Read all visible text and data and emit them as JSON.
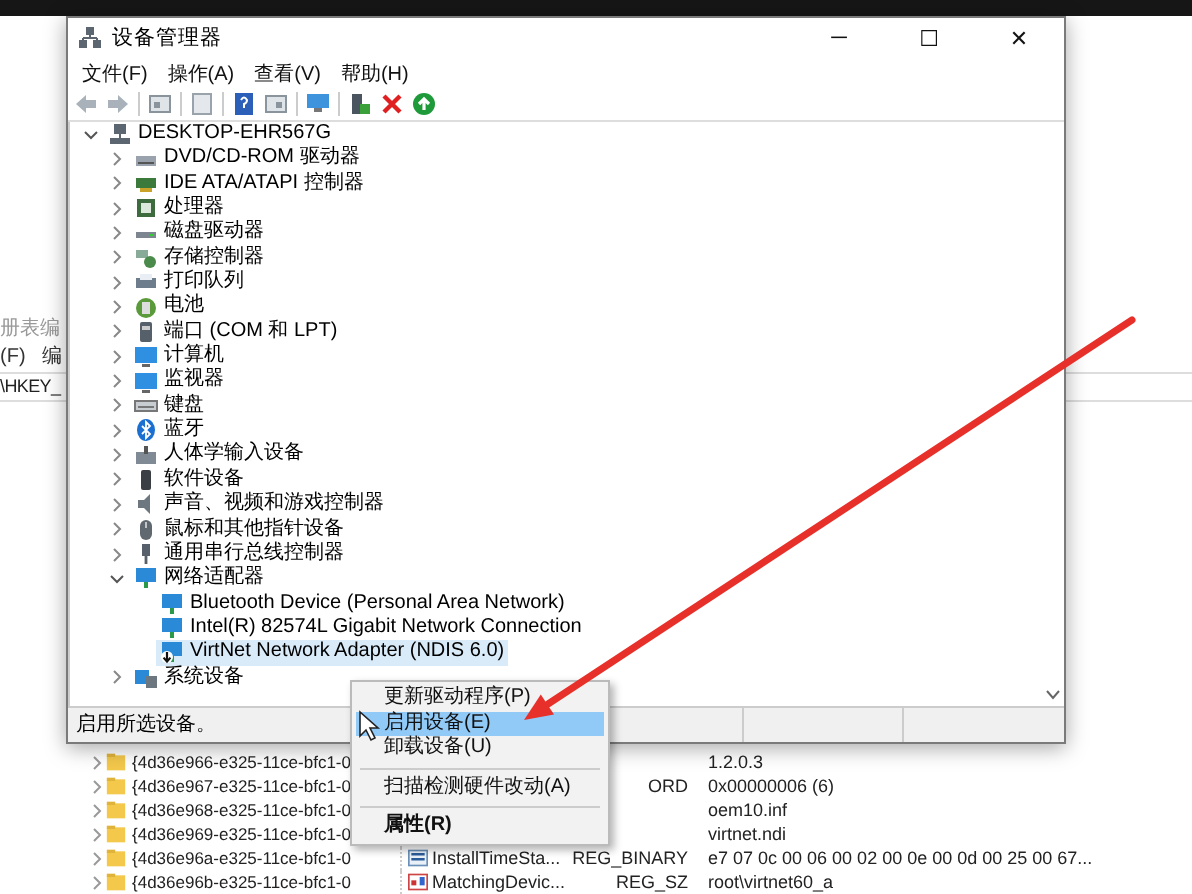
{
  "registry_window": {
    "title": "册表编",
    "menu": [
      "(F)",
      "编"
    ],
    "address": "\\HKEY_",
    "rows": [
      {
        "key": "{4d36e966-e325-11ce-bfc1-0",
        "data": "1.2.0.3"
      },
      {
        "key": "{4d36e967-e325-11ce-bfc1-0",
        "type": "ORD",
        "data": "0x00000006 (6)"
      },
      {
        "key": "{4d36e968-e325-11ce-bfc1-0",
        "data": "oem10.inf"
      },
      {
        "key": "{4d36e969-e325-11ce-bfc1-0",
        "data": "virtnet.ndi"
      },
      {
        "key": "{4d36e96a-e325-11ce-bfc1-0",
        "kind": "binary",
        "name": "InstallTimeSta...",
        "type": "REG_BINARY",
        "data": "e7 07 0c 00 06 00 02 00 0e 00 0d 00 25 00 67..."
      },
      {
        "key": "{4d36e96b-e325-11ce-bfc1-0",
        "kind": "string",
        "name": "MatchingDevic...",
        "type": "REG_SZ",
        "data": "root\\virtnet60_a"
      }
    ]
  },
  "window": {
    "title": "设备管理器",
    "controls": [
      "─",
      "☐",
      "✕"
    ]
  },
  "menu": [
    "文件(F)",
    "操作(A)",
    "查看(V)",
    "帮助(H)"
  ],
  "device_tree": {
    "label": "DESKTOP-EHR567G",
    "expanded": true,
    "selected": false,
    "children": [
      {
        "label": "DVD/CD-ROM 驱动器",
        "expanded": false,
        "selected": false
      },
      {
        "label": "IDE ATA/ATAPI 控制器",
        "expanded": false,
        "selected": false
      },
      {
        "label": "处理器",
        "expanded": false,
        "selected": false
      },
      {
        "label": "磁盘驱动器",
        "expanded": false,
        "selected": false
      },
      {
        "label": "存储控制器",
        "expanded": false,
        "selected": false
      },
      {
        "label": "打印队列",
        "expanded": false,
        "selected": false
      },
      {
        "label": "电池",
        "expanded": false,
        "selected": false
      },
      {
        "label": "端口 (COM 和 LPT)",
        "expanded": false,
        "selected": false
      },
      {
        "label": "计算机",
        "expanded": false,
        "selected": false
      },
      {
        "label": "监视器",
        "expanded": false,
        "selected": false
      },
      {
        "label": "键盘",
        "expanded": false,
        "selected": false
      },
      {
        "label": "蓝牙",
        "expanded": false,
        "selected": false
      },
      {
        "label": "人体学输入设备",
        "expanded": false,
        "selected": false
      },
      {
        "label": "软件设备",
        "expanded": false,
        "selected": false
      },
      {
        "label": "声音、视频和游戏控制器",
        "expanded": false,
        "selected": false
      },
      {
        "label": "鼠标和其他指针设备",
        "expanded": false,
        "selected": false
      },
      {
        "label": "通用串行总线控制器",
        "expanded": false,
        "selected": false
      },
      {
        "label": "网络适配器",
        "expanded": true,
        "selected": false,
        "children": [
          {
            "label": "Bluetooth Device (Personal Area Network)",
            "selected": false,
            "disabled": false
          },
          {
            "label": "Intel(R) 82574L Gigabit Network Connection",
            "selected": false,
            "disabled": false
          },
          {
            "label": "VirtNet Network Adapter (NDIS 6.0)",
            "selected": true,
            "disabled": true
          }
        ]
      },
      {
        "label": "系统设备",
        "expanded": false,
        "selected": false
      }
    ]
  },
  "status_bar": "启用所选设备。",
  "context_menu": [
    {
      "label": "更新驱动程序(P)",
      "selected": false,
      "default": false
    },
    {
      "label": "启用设备(E)",
      "selected": true,
      "default": false
    },
    {
      "label": "卸载设备(U)",
      "selected": false,
      "default": false,
      "separator_after": true
    },
    {
      "label": "扫描检测硬件改动(A)",
      "selected": false,
      "default": false,
      "separator_after": true
    },
    {
      "label": "属性(R)",
      "selected": false,
      "default": true
    }
  ]
}
